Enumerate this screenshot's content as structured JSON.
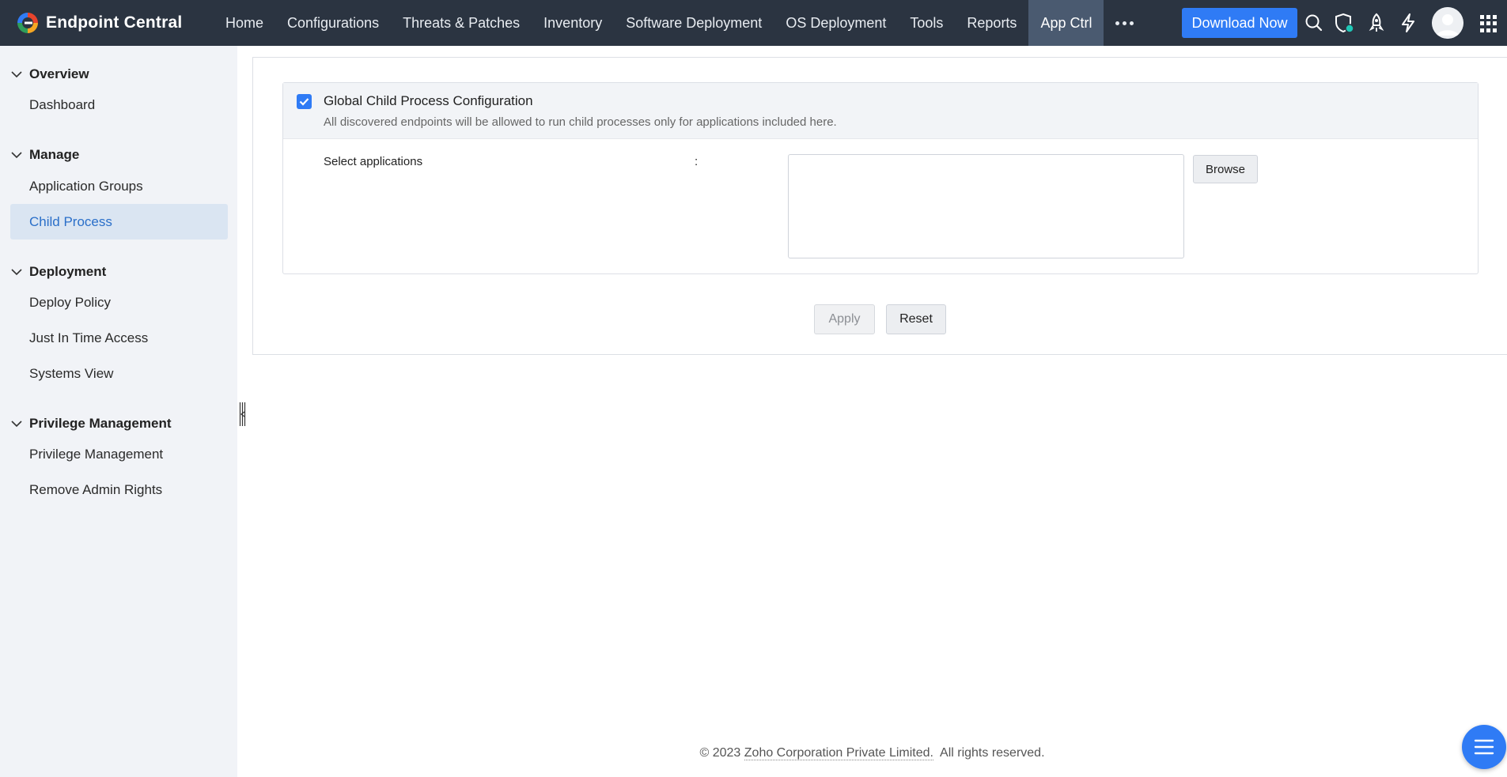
{
  "app": {
    "name": "Endpoint Central"
  },
  "nav": {
    "items": [
      "Home",
      "Configurations",
      "Threats & Patches",
      "Inventory",
      "Software Deployment",
      "OS Deployment",
      "Tools",
      "Reports",
      "App Ctrl"
    ],
    "active": "App Ctrl",
    "download_label": "Download Now"
  },
  "icons": {
    "brand": "endpoint-central-logo",
    "more": "more-horizontal-icon",
    "search": "search-icon",
    "security": "shield-icon",
    "launch": "rocket-icon",
    "quick_actions": "lightning-icon",
    "profile": "avatar",
    "apps": "grid-icon",
    "fab": "menu-icon"
  },
  "sidebar": {
    "sections": [
      {
        "title": "Overview",
        "items": [
          {
            "label": "Dashboard"
          }
        ]
      },
      {
        "title": "Manage",
        "items": [
          {
            "label": "Application Groups"
          },
          {
            "label": "Child Process",
            "active": true
          }
        ]
      },
      {
        "title": "Deployment",
        "items": [
          {
            "label": "Deploy Policy"
          },
          {
            "label": "Just In Time Access"
          },
          {
            "label": "Systems View"
          }
        ]
      },
      {
        "title": "Privilege Management",
        "items": [
          {
            "label": "Privilege Management"
          },
          {
            "label": "Remove Admin Rights"
          }
        ]
      }
    ]
  },
  "config": {
    "checked": true,
    "title": "Global Child Process Configuration",
    "description": "All discovered endpoints will be allowed to run child processes only for applications included here.",
    "select_label": "Select applications",
    "colon": ":",
    "applications_value": "",
    "browse_label": "Browse"
  },
  "actions": {
    "apply_label": "Apply",
    "apply_enabled": false,
    "reset_label": "Reset"
  },
  "footer": {
    "prefix": "© 2023",
    "company": "Zoho Corporation Private Limited.",
    "suffix": "All rights reserved."
  },
  "colors": {
    "topbar": "#2b3441",
    "accent": "#2f7bf5",
    "sidebar_bg": "#f1f3f7",
    "active_item_bg": "#dae5f2",
    "active_item_text": "#2a6fc9"
  }
}
